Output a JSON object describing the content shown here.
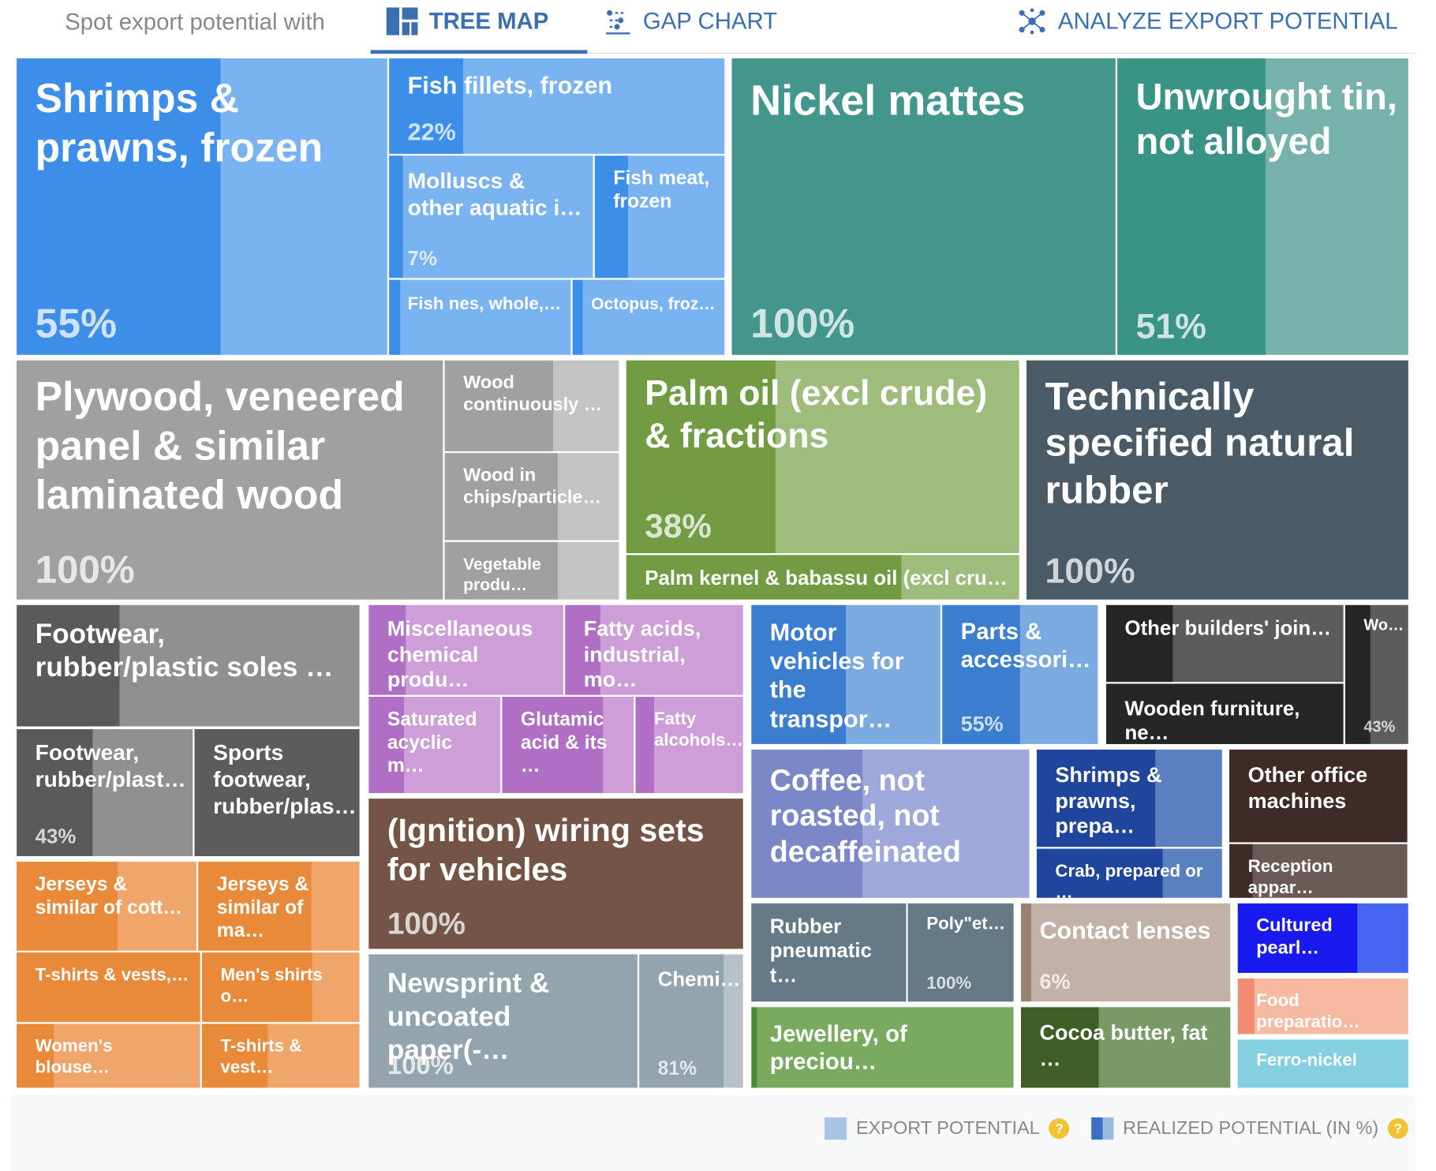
{
  "header": {
    "intro_label": "Spot export potential with",
    "tabs": [
      {
        "label": "TREE MAP",
        "icon": "treemap-icon",
        "active": true
      },
      {
        "label": "GAP CHART",
        "icon": "gap-chart-icon",
        "active": false
      },
      {
        "label": "ANALYZE EXPORT POTENTIAL",
        "icon": "network-icon",
        "active": false
      }
    ]
  },
  "legend": {
    "export_potential": "EXPORT POTENTIAL",
    "realized_potential": "REALIZED POTENTIAL (IN %)",
    "help_icon": "?"
  },
  "chart_data": {
    "type": "treemap",
    "value_meaning": "realized potential (in %)",
    "tiles": [
      {
        "label": "Shrimps & prawns, frozen",
        "realized": 55,
        "pct_label": "55%",
        "color": "#7ab3f2",
        "dark": "#3d8ee8"
      },
      {
        "label": "Fish fillets, frozen",
        "realized": 22,
        "pct_label": "22%",
        "color": "#7ab3f2",
        "dark": "#3d8ee8"
      },
      {
        "label": "Molluscs & other aquatic i…",
        "realized": 7,
        "pct_label": "7%",
        "color": "#7ab3f2",
        "dark": "#3d8ee8"
      },
      {
        "label": "Fish meat, frozen",
        "realized": null,
        "pct_label": "",
        "color": "#7ab3f2",
        "dark": "#3d8ee8"
      },
      {
        "label": "Fish nes, whole,…",
        "realized": null,
        "pct_label": "",
        "color": "#7ab3f2",
        "dark": "#3d8ee8"
      },
      {
        "label": "Octopus, froz…",
        "realized": null,
        "pct_label": "",
        "color": "#7ab3f2",
        "dark": "#3d8ee8"
      },
      {
        "label": "Nickel mattes",
        "realized": 100,
        "pct_label": "100%",
        "color": "#43968b",
        "dark": "#43968b"
      },
      {
        "label": "Unwrought tin, not alloyed",
        "realized": 51,
        "pct_label": "51%",
        "color": "#76b2a9",
        "dark": "#3a9485"
      },
      {
        "label": "Plywood, veneered panel & similar laminated wood",
        "realized": 100,
        "pct_label": "100%",
        "color": "#a0a0a0",
        "dark": "#a0a0a0"
      },
      {
        "label": "Wood continuously …",
        "realized": null,
        "pct_label": "",
        "color": "#c3c3c3",
        "dark": "#a0a0a0"
      },
      {
        "label": "Wood in chips/particle…",
        "realized": null,
        "pct_label": "",
        "color": "#c3c3c3",
        "dark": "#a0a0a0"
      },
      {
        "label": "Vegetable produ…",
        "realized": null,
        "pct_label": "",
        "color": "#c3c3c3",
        "dark": "#a0a0a0"
      },
      {
        "label": "Palm oil (excl crude) & fractions",
        "realized": 38,
        "pct_label": "38%",
        "color": "#9ebc7c",
        "dark": "#729c43"
      },
      {
        "label": "Palm kernel & babassu oil (excl cru…",
        "realized": null,
        "pct_label": "",
        "color": "#9ebc7c",
        "dark": "#729c43"
      },
      {
        "label": "Technically specified natural rubber",
        "realized": 100,
        "pct_label": "100%",
        "color": "#4a5a66",
        "dark": "#4a5a66"
      },
      {
        "label": "Footwear, rubber/plastic soles …",
        "realized": null,
        "pct_label": "",
        "color": "#909090",
        "dark": "#5a5a5a"
      },
      {
        "label": "Footwear, rubber/plast…",
        "realized": 43,
        "pct_label": "43%",
        "color": "#909090",
        "dark": "#5a5a5a"
      },
      {
        "label": "Sports footwear, rubber/plas…",
        "realized": null,
        "pct_label": "",
        "color": "#5c5c5c",
        "dark": "#5c5c5c"
      },
      {
        "label": "Jerseys & similar of cott…",
        "realized": null,
        "pct_label": "",
        "color": "#f0a56a",
        "dark": "#e98a3a"
      },
      {
        "label": "Jerseys & similar of ma…",
        "realized": null,
        "pct_label": "",
        "color": "#f0a56a",
        "dark": "#e98a3a"
      },
      {
        "label": "T-shirts & vests,…",
        "realized": null,
        "pct_label": "",
        "color": "#e98a3a",
        "dark": "#e98a3a"
      },
      {
        "label": "Men's shirts o…",
        "realized": null,
        "pct_label": "",
        "color": "#f0a56a",
        "dark": "#e98a3a"
      },
      {
        "label": "Women's blouse…",
        "realized": null,
        "pct_label": "",
        "color": "#f0a56a",
        "dark": "#e98a3a"
      },
      {
        "label": "T-shirts & vest…",
        "realized": null,
        "pct_label": "",
        "color": "#f0a56a",
        "dark": "#e98a3a"
      },
      {
        "label": "Miscellaneous chemical produ…",
        "realized": null,
        "pct_label": "",
        "color": "#cd9ed8",
        "dark": "#b06ec4"
      },
      {
        "label": "Fatty acids, industrial, mo…",
        "realized": null,
        "pct_label": "",
        "color": "#cd9ed8",
        "dark": "#b06ec4"
      },
      {
        "label": "Saturated acyclic m…",
        "realized": null,
        "pct_label": "",
        "color": "#cd9ed8",
        "dark": "#b06ec4"
      },
      {
        "label": "Glutamic acid & its …",
        "realized": null,
        "pct_label": "",
        "color": "#cd9ed8",
        "dark": "#b06ec4"
      },
      {
        "label": "Fatty alcohols…",
        "realized": null,
        "pct_label": "",
        "color": "#cd9ed8",
        "dark": "#b06ec4"
      },
      {
        "label": "(Ignition) wiring sets for vehicles",
        "realized": 100,
        "pct_label": "100%",
        "color": "#735447",
        "dark": "#735447"
      },
      {
        "label": "Newsprint & uncoated paper(-…",
        "realized": 100,
        "pct_label": "100%",
        "color": "#94a4ae",
        "dark": "#94a4ae"
      },
      {
        "label": "Chemi…",
        "realized": 81,
        "pct_label": "81%",
        "color": "#b7c2c8",
        "dark": "#94a4ae"
      },
      {
        "label": "Motor vehicles for the transpor…",
        "realized": null,
        "pct_label": "",
        "color": "#7aaae0",
        "dark": "#3b7ed0"
      },
      {
        "label": "Parts & accessori…",
        "realized": 55,
        "pct_label": "55%",
        "color": "#7aaae0",
        "dark": "#3b7ed0"
      },
      {
        "label": "Other builders' join…",
        "realized": null,
        "pct_label": "",
        "color": "#5c5c5c",
        "dark": "#262626"
      },
      {
        "label": "Wooden furniture, ne…",
        "realized": null,
        "pct_label": "",
        "color": "#262626",
        "dark": "#262626"
      },
      {
        "label": "Wo…",
        "realized": 43,
        "pct_label": "43%",
        "color": "#5c5c5c",
        "dark": "#262626"
      },
      {
        "label": "Coffee, not roasted, not decaffeinated",
        "realized": null,
        "pct_label": "",
        "color": "#9ea8da",
        "dark": "#7c87c8"
      },
      {
        "label": "Shrimps & prawns, prepa…",
        "realized": null,
        "pct_label": "",
        "color": "#5a80c0",
        "dark": "#1f469c"
      },
      {
        "label": "Crab, prepared or …",
        "realized": null,
        "pct_label": "",
        "color": "#5a80c0",
        "dark": "#1f469c"
      },
      {
        "label": "Other office machines",
        "realized": null,
        "pct_label": "",
        "color": "#3e2a26",
        "dark": "#3e2a26"
      },
      {
        "label": "Reception appar…",
        "realized": null,
        "pct_label": "",
        "color": "#6a5a58",
        "dark": "#3e2a26"
      },
      {
        "label": "Rubber pneumatic t…",
        "realized": null,
        "pct_label": "",
        "color": "#657a86",
        "dark": "#657a86"
      },
      {
        "label": "Poly\"et…",
        "realized": 100,
        "pct_label": "100%",
        "color": "#657a86",
        "dark": "#657a86"
      },
      {
        "label": "Contact lenses",
        "realized": 6,
        "pct_label": "6%",
        "color": "#c2b1a8",
        "dark": "#9a8273"
      },
      {
        "label": "Cultured pearl…",
        "realized": null,
        "pct_label": "",
        "color": "#4666f2",
        "dark": "#1a1af0"
      },
      {
        "label": "Jewellery, of preciou…",
        "realized": null,
        "pct_label": "",
        "color": "#79aa60",
        "dark": "#4e8a36"
      },
      {
        "label": "Cocoa butter, fat …",
        "realized": null,
        "pct_label": "",
        "color": "#799a66",
        "dark": "#3e5e26"
      },
      {
        "label": "Food preparatio…",
        "realized": null,
        "pct_label": "",
        "color": "#f7b9a0",
        "dark": "#f28c70"
      },
      {
        "label": "Ferro-nickel",
        "realized": null,
        "pct_label": "",
        "color": "#85d0e0",
        "dark": "#85d0e0"
      }
    ]
  }
}
